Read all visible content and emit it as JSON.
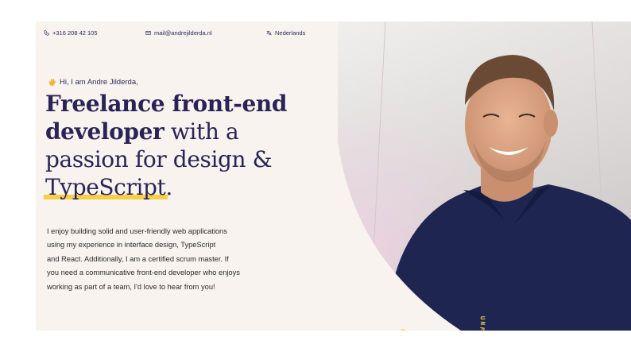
{
  "contact": {
    "phone": "+316 208 42 105",
    "email": "mail@andrejilderda.nl",
    "language": "Nederlands"
  },
  "hero": {
    "greeting": "Hi, I am Andre Jilderda,",
    "headline": {
      "line1_bold": "Freelance front-end",
      "line2_bold": "developer",
      "line2_light": " with a",
      "line3_light": "passion for design &",
      "line4_highlight": "TypeScript",
      "line4_tail": "."
    },
    "description": "I enjoy building solid and user-friendly web applications using my experience in interface design, TypeScript and React. Additionally, I am a certified scrum master. If you need a communicative front-end developer who enjoys working as part of a team, I'd love to hear from you!",
    "description_lines": [
      "I enjoy building solid and user-friendly web applications",
      "using my experience in interface design, TypeScript",
      "and React. Additionally, I am a certified scrum master. If",
      "you need a communicative front-end developer who enjoys",
      "working as part of a team, I'd love to hear from you!"
    ],
    "stamp_text": "UNFORTUNATELY CURRENTLY I'M NOT AVAILABLE"
  },
  "colors": {
    "background": "#f8f3ee",
    "heading": "#2a2456",
    "highlight": "#f6cf45",
    "stamp": "#f6cf45",
    "shirt": "#1d2550"
  },
  "icons": {
    "phone": "phone-icon",
    "email": "mail-icon",
    "language": "translate-icon",
    "greeting": "waving-hand-icon"
  }
}
